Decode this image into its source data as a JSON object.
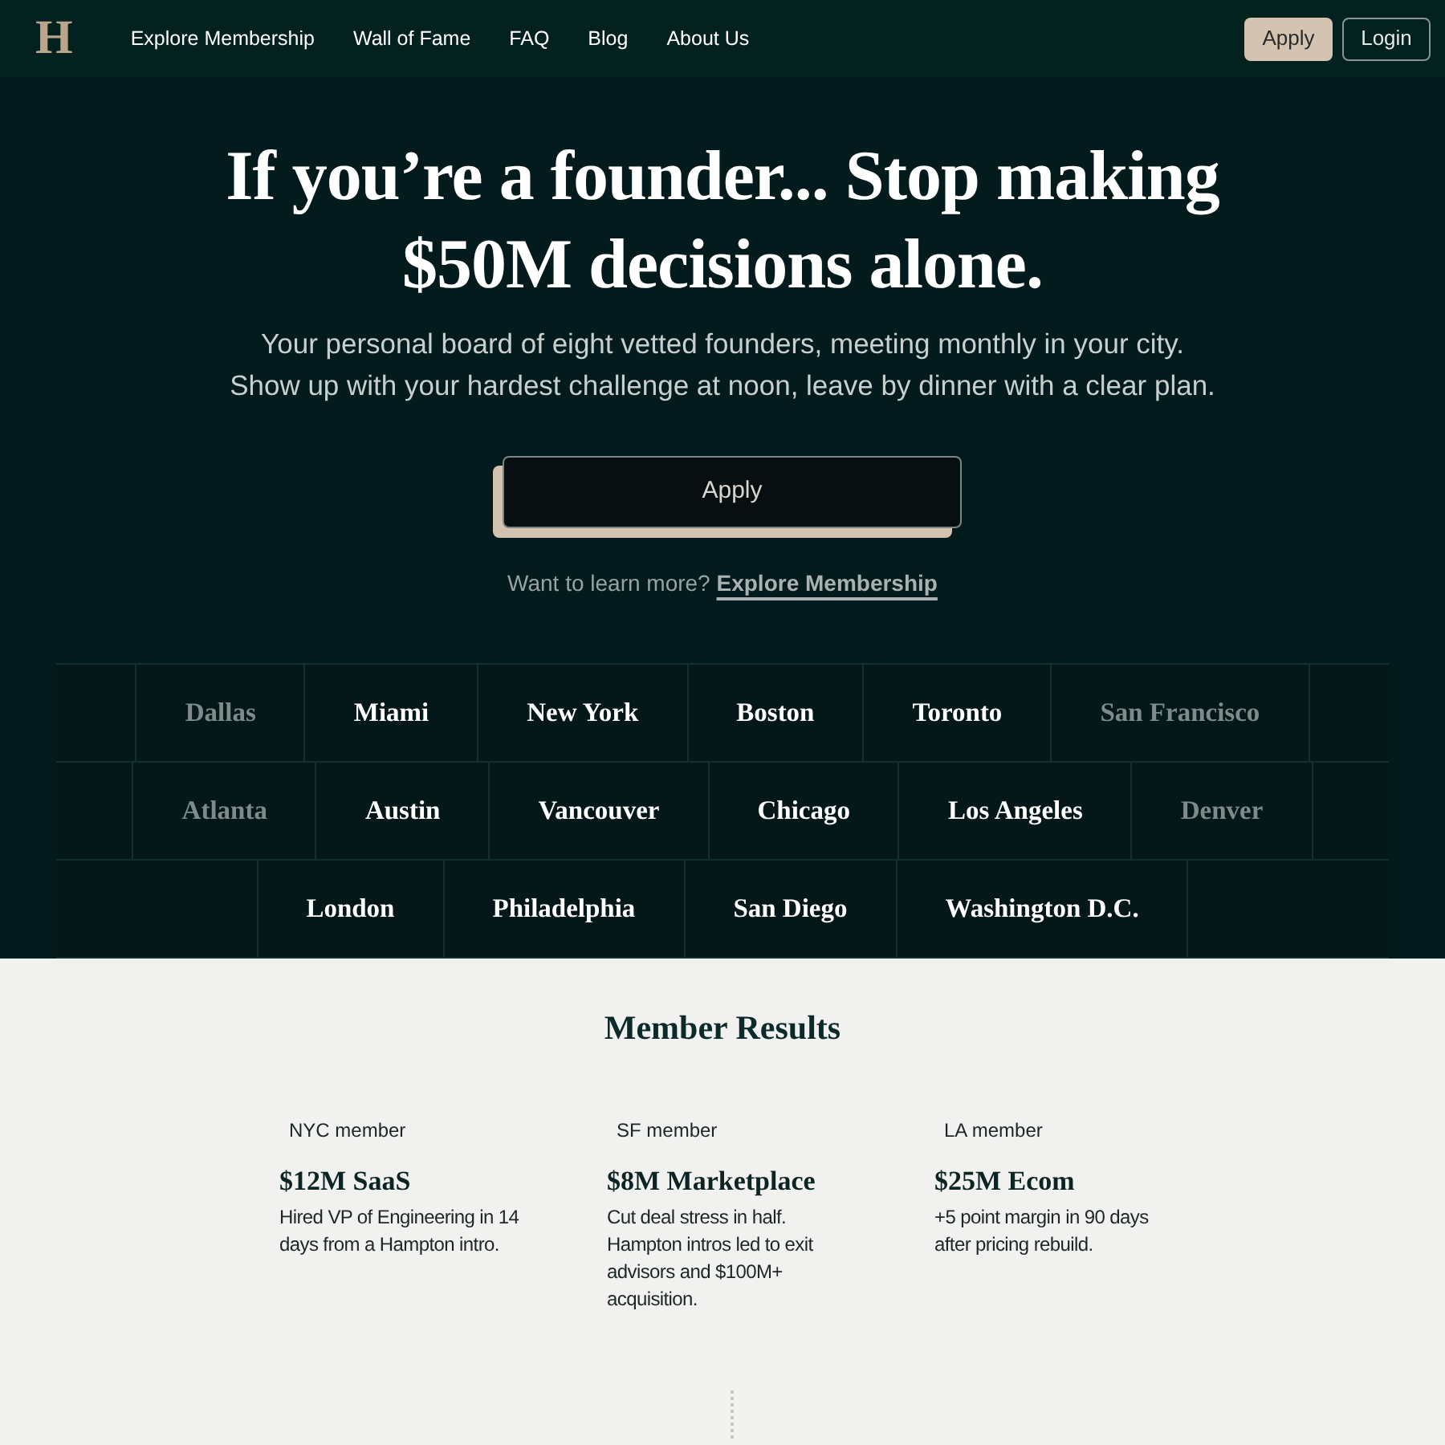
{
  "nav": {
    "logo": "H",
    "links": [
      {
        "label": "Explore Membership"
      },
      {
        "label": "Wall of Fame"
      },
      {
        "label": "FAQ"
      },
      {
        "label": "Blog"
      },
      {
        "label": "About Us"
      }
    ],
    "apply_button": "Apply",
    "login_button": "Login"
  },
  "hero": {
    "title_lines": [
      "If you’re a founder... Stop making",
      "$50M decisions alone."
    ],
    "subtitle_lines": [
      "Your personal board of eight vetted founders, meeting monthly in your city.",
      "Show up with your hardest challenge at noon, leave by dinner with a clear plan."
    ],
    "cta": "Apply",
    "learn_more": {
      "text": "Want to learn more?",
      "link": "Explore Membership"
    }
  },
  "city_strips": [
    {
      "cities": [
        {
          "name": "Dallas",
          "dimmed": true
        },
        {
          "name": "Miami",
          "dimmed": false
        },
        {
          "name": "New York",
          "dimmed": false
        },
        {
          "name": "Boston",
          "dimmed": false
        },
        {
          "name": "Toronto",
          "dimmed": false
        },
        {
          "name": "San Francisco",
          "dimmed": true
        }
      ]
    },
    {
      "cities": [
        {
          "name": "Atlanta",
          "dimmed": true
        },
        {
          "name": "Austin",
          "dimmed": false
        },
        {
          "name": "Vancouver",
          "dimmed": false
        },
        {
          "name": "Chicago",
          "dimmed": false
        },
        {
          "name": "Los Angeles",
          "dimmed": false
        },
        {
          "name": "Denver",
          "dimmed": true
        }
      ]
    },
    {
      "cities": [
        {
          "name": "London",
          "dimmed": false
        },
        {
          "name": "Philadelphia",
          "dimmed": false
        },
        {
          "name": "San Diego",
          "dimmed": false
        },
        {
          "name": "Washington D.C.",
          "dimmed": false
        }
      ]
    }
  ],
  "results": {
    "title": "Member Results",
    "items": [
      {
        "label": "NYC member",
        "headline": "$12M SaaS",
        "text": "Hired VP of Engineering in 14 days from a Hampton intro."
      },
      {
        "label": "SF member",
        "headline": "$8M Marketplace",
        "text": "Cut deal stress in half. Hampton intros led to exit advisors and $100M+ acquisition."
      },
      {
        "label": "LA member",
        "headline": "$25M Ecom",
        "text": "+5 point margin in 90 days after pricing rebuild."
      }
    ]
  }
}
